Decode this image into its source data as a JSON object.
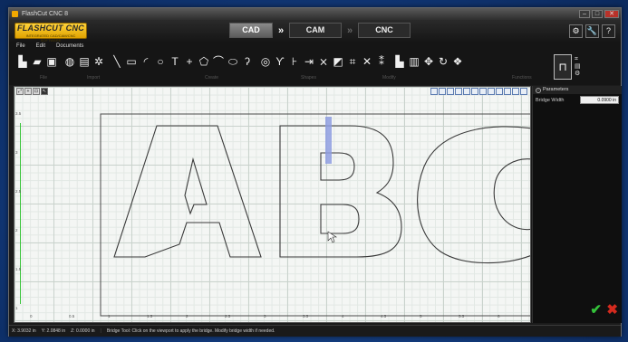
{
  "window": {
    "title": "FlashCut CNC 8"
  },
  "logo": {
    "text": "FLASHCUT CNC",
    "subtitle": "INTEGRATED CAD/CAM/CNC SOFTWARE"
  },
  "modes": [
    {
      "label": "CAD",
      "active": true
    },
    {
      "label": "CAM",
      "active": false
    },
    {
      "label": "CNC",
      "active": false
    }
  ],
  "top_icons": [
    "settings-icon",
    "wrench-icon",
    "help-icon"
  ],
  "help_glyph": "?",
  "menu": [
    "File",
    "Edit",
    "Documents"
  ],
  "toolbar": {
    "groups": [
      "File",
      "Import",
      "Create",
      "Shapes",
      "Modify",
      "Functions"
    ]
  },
  "viewport": {
    "y_ticks": [
      "3.5",
      "3",
      "2.5",
      "2",
      "1.5",
      "1"
    ],
    "x_ticks": [
      "0",
      "0.5",
      "1",
      "1.5",
      "2",
      "2.5",
      "3",
      "3.5",
      "4",
      "4.5",
      "5",
      "5.5",
      "6"
    ],
    "grid_color": "#c9d2cc",
    "highlight_color": "#8e9ee0"
  },
  "params": {
    "header": "Parameters",
    "bridge_width_label": "Bridge Width",
    "bridge_width_value": "0.0900 in"
  },
  "status": {
    "x": "X: 3.9032 in",
    "y": "Y: 2.0848 in",
    "z": "Z: 0.0000 in",
    "message": "Bridge Tool: Click on the viewport to apply the bridge. Modify bridge width if needed."
  }
}
